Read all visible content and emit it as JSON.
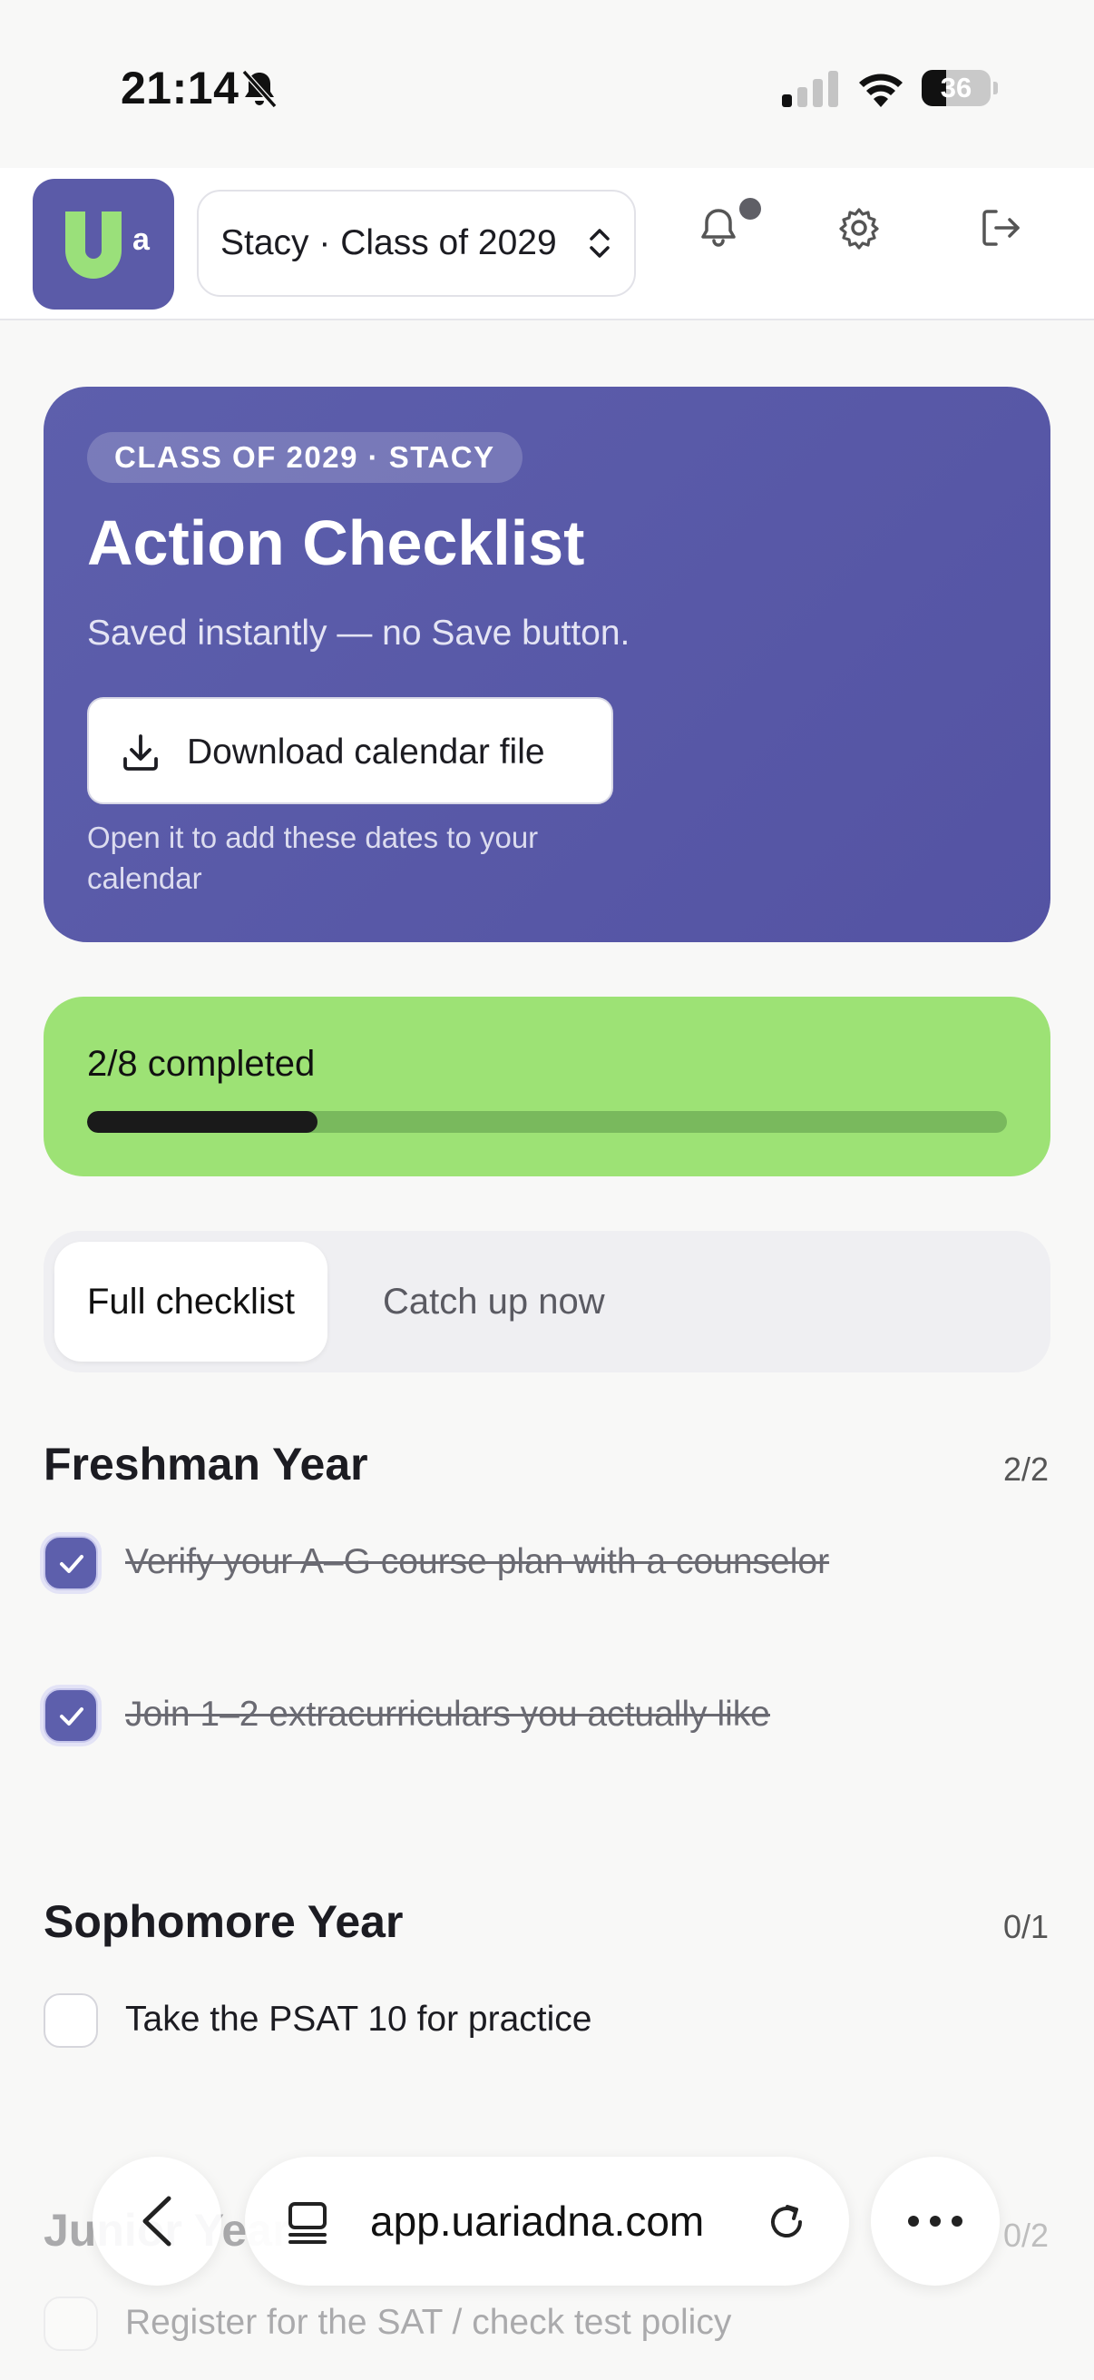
{
  "status_bar": {
    "time": "21:14",
    "battery_percent": "36",
    "battery_level": 0.36,
    "icons": [
      "bell-slash-icon",
      "cellular-signal-icon",
      "wifi-icon",
      "battery-icon"
    ]
  },
  "header": {
    "profile_selector": "Stacy · Class of 2029",
    "has_notification": true,
    "icons": [
      "notifications-bell-icon",
      "settings-gear-icon",
      "logout-icon"
    ]
  },
  "hero": {
    "badge": "CLASS OF 2029 · STACY",
    "title": "Action Checklist",
    "subtitle": "Saved instantly — no Save button.",
    "download_button": "Download calendar file",
    "note": "Open it to add these dates to your calendar"
  },
  "progress": {
    "label": "2/8 completed",
    "completed": 2,
    "total": 8
  },
  "tabs": [
    {
      "label": "Full checklist",
      "active": true
    },
    {
      "label": "Catch up now",
      "active": false
    }
  ],
  "sections": [
    {
      "title": "Freshman Year",
      "count": "2/2",
      "items": [
        {
          "label": "Verify your A–G course plan with a counselor",
          "checked": true
        },
        {
          "label": "Join 1–2 extracurriculars you actually like",
          "checked": true
        }
      ]
    },
    {
      "title": "Sophomore Year",
      "count": "0/1",
      "items": [
        {
          "label": "Take the PSAT 10 for practice",
          "checked": false
        }
      ]
    },
    {
      "title": "Junior Year",
      "count": "0/2",
      "items": [
        {
          "label": "Register for the SAT / check test policy",
          "checked": false
        }
      ]
    }
  ],
  "browser": {
    "url": "app.uariadna.com"
  },
  "colors": {
    "brand_purple": "#5d5fac",
    "progress_green": "#9de275",
    "progress_fill": "#1a1a1a"
  }
}
